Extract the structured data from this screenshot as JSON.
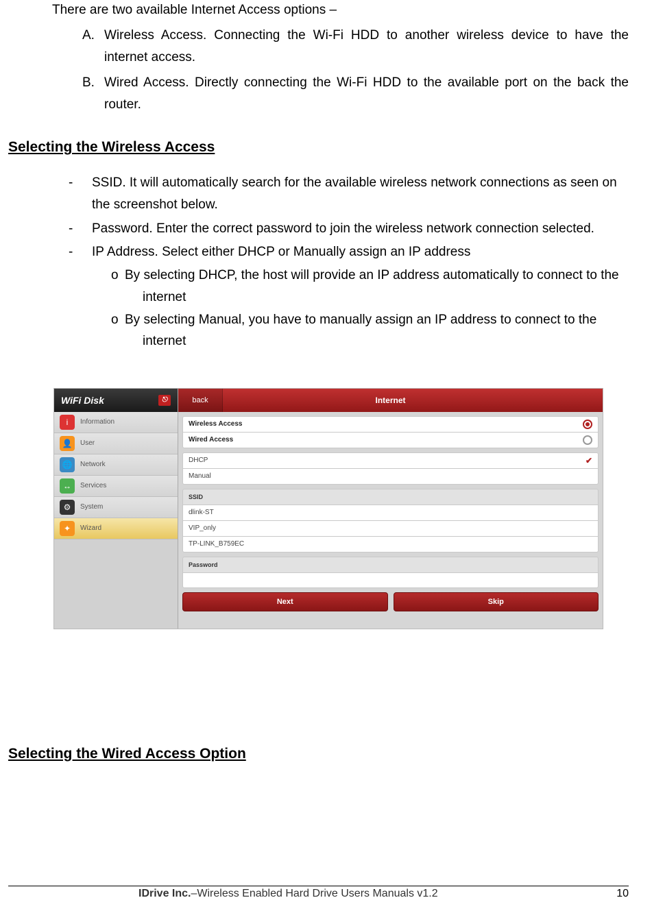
{
  "intro": "There are two available Internet Access options –",
  "letters": [
    {
      "m": "A.",
      "t": "Wireless Access.  Connecting the Wi-Fi HDD to another wireless device to have the internet access."
    },
    {
      "m": "B.",
      "t": "Wired Access. Directly connecting the Wi-Fi HDD to the available port on the back the router."
    }
  ],
  "h_wireless": "Selecting the Wireless Access",
  "dashes": [
    {
      "m": "-",
      "t": "SSID.    It will automatically search for the available wireless network connections as seen on the screenshot below."
    },
    {
      "m": "-",
      "t": "Password.    Enter the correct password to join the wireless network connection selected."
    },
    {
      "m": "-",
      "t": "IP Address.    Select either DHCP or Manually assign an IP address"
    }
  ],
  "olist": [
    {
      "m": "o",
      "t1": "By selecting DHCP, the host will provide an IP address automatically to connect to the",
      "t2": "internet"
    },
    {
      "m": "o",
      "t1": "By selecting Manual, you have to manually assign an IP address to connect to the",
      "t2": "internet"
    }
  ],
  "h_wired": "Selecting the Wired Access Option",
  "footer": {
    "brand": "IDrive Inc.",
    "sub": "–Wireless Enabled Hard Drive    Users Manuals v1.2",
    "page": "10"
  },
  "ui": {
    "brand": "WiFi Disk",
    "nav": [
      {
        "label": "Information",
        "icon": "ic-info",
        "glyph": "i",
        "active": false,
        "dn": "nav-information"
      },
      {
        "label": "User",
        "icon": "ic-user",
        "glyph": "👤",
        "active": false,
        "dn": "nav-user"
      },
      {
        "label": "Network",
        "icon": "ic-net",
        "glyph": "🌐",
        "active": false,
        "dn": "nav-network"
      },
      {
        "label": "Services",
        "icon": "ic-serv",
        "glyph": "↔",
        "active": false,
        "dn": "nav-services"
      },
      {
        "label": "System",
        "icon": "ic-sys",
        "glyph": "⚙",
        "active": false,
        "dn": "nav-system"
      },
      {
        "label": "Wizard",
        "icon": "ic-wiz",
        "glyph": "✦",
        "active": true,
        "dn": "nav-wizard"
      }
    ],
    "back": "back",
    "title": "Internet",
    "access": {
      "wireless": "Wireless Access",
      "wired": "Wired Access"
    },
    "mode": {
      "dhcp": "DHCP",
      "manual": "Manual"
    },
    "ssid_header": "SSID",
    "ssids": [
      "dlink-ST",
      "VIP_only",
      "TP-LINK_B759EC"
    ],
    "pw_header": "Password",
    "pw_value": "",
    "btn_next": "Next",
    "btn_skip": "Skip"
  }
}
